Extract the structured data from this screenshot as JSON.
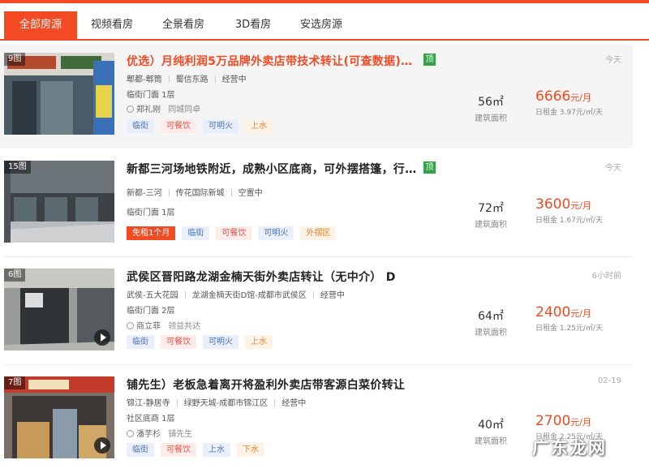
{
  "tabs": [
    {
      "label": "全部房源",
      "active": true
    },
    {
      "label": "视频看房",
      "active": false
    },
    {
      "label": "全景看房",
      "active": false
    },
    {
      "label": "3D看房",
      "active": false
    },
    {
      "label": "安选房源",
      "active": false
    }
  ],
  "listings": [
    {
      "photo_count": "9图",
      "title": "优选）月纯利润5万品牌外卖店带技术转让(可查数据)6…",
      "top_badge": "顶",
      "district": "郫都-郫筒",
      "road": "蜀信东路",
      "status": "经营中",
      "floor": "临街门面 1层",
      "agent": "郑礼刚",
      "agent_note": "同城同卓",
      "tags": [
        "临街",
        "可餐饮",
        "可明火",
        "上水"
      ],
      "area": "56㎡",
      "area_label": "建筑面积",
      "price": "6666",
      "price_unit": "元/月",
      "daily_rent": "日租金 3.97元/㎡/天",
      "time": "今天"
    },
    {
      "photo_count": "15图",
      "title": "新都三河场地铁附近，成熟小区底商，可外摆搭篷，行…",
      "top_badge": "顶",
      "district": "新都-三河",
      "road": "传花国际新城",
      "status": "空置中",
      "floor": "临街门面 1层",
      "tags": [
        "免租1个月",
        "临街",
        "可餐饮",
        "可明火",
        "外摆区"
      ],
      "area": "72㎡",
      "area_label": "建筑面积",
      "price": "3600",
      "price_unit": "元/月",
      "daily_rent": "日租金 1.67元/㎡/天",
      "time": "今天"
    },
    {
      "photo_count": "6图",
      "title": "武侯区晋阳路龙湖金楠天街外卖店转让（无中介） D",
      "district": "武侯-五大花园",
      "road": "龙湖金楠天街D馆-成都市武侯区",
      "status": "经营中",
      "floor": "临街门面 2层",
      "agent": "商立菲",
      "agent_note": "领益共达",
      "tags": [
        "临街",
        "可餐饮",
        "可明火",
        "上水"
      ],
      "area": "64㎡",
      "area_label": "建筑面积",
      "price": "2400",
      "price_unit": "元/月",
      "daily_rent": "日租金 1.25元/㎡/天",
      "time": "6小时前"
    },
    {
      "photo_count": "7图",
      "title": "铺先生）老板急着离开将盈利外卖店带客源白菜价转让",
      "district": "锦江-静居寺",
      "road": "绿野天城-成都市锦江区",
      "status": "经营中",
      "floor": "社区底商 1层",
      "agent": "潘芋杉",
      "agent_note": "铺先生",
      "tags": [
        "临街",
        "可餐饮",
        "上水",
        "下水"
      ],
      "area": "40㎡",
      "area_label": "建筑面积",
      "price": "2700",
      "price_unit": "元/月",
      "daily_rent": "日租金 2.25元/㎡/天",
      "time": "02-19"
    }
  ],
  "watermark": "广东龙网",
  "colors": {
    "accent": "#f24b24",
    "top_badge": "#37a04a"
  }
}
